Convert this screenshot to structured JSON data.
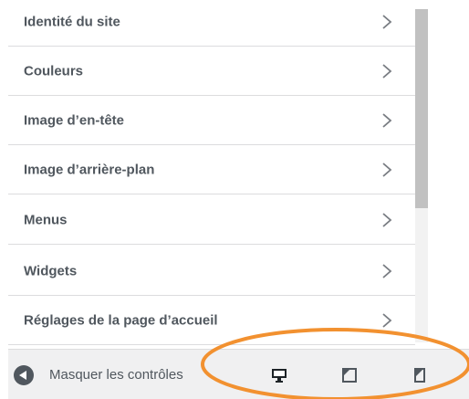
{
  "menu": {
    "items": [
      {
        "label": "Identité du site"
      },
      {
        "label": "Couleurs"
      },
      {
        "label": "Image d’en-tête"
      },
      {
        "label": "Image d’arrière-plan"
      },
      {
        "label": "Menus"
      },
      {
        "label": "Widgets"
      },
      {
        "label": "Réglages de la page d’accueil"
      }
    ]
  },
  "footer": {
    "collapse_label": "Masquer les contrôles",
    "collapse_icon": "arrow-left-circle-icon",
    "devices": [
      {
        "name": "desktop",
        "icon": "desktop-icon",
        "active": true
      },
      {
        "name": "tablet",
        "icon": "tablet-icon",
        "active": false
      },
      {
        "name": "mobile",
        "icon": "mobile-icon",
        "active": false
      }
    ]
  },
  "colors": {
    "text": "#50575e",
    "footer_bg": "#f0f0f1",
    "annotation": "#f29130"
  }
}
